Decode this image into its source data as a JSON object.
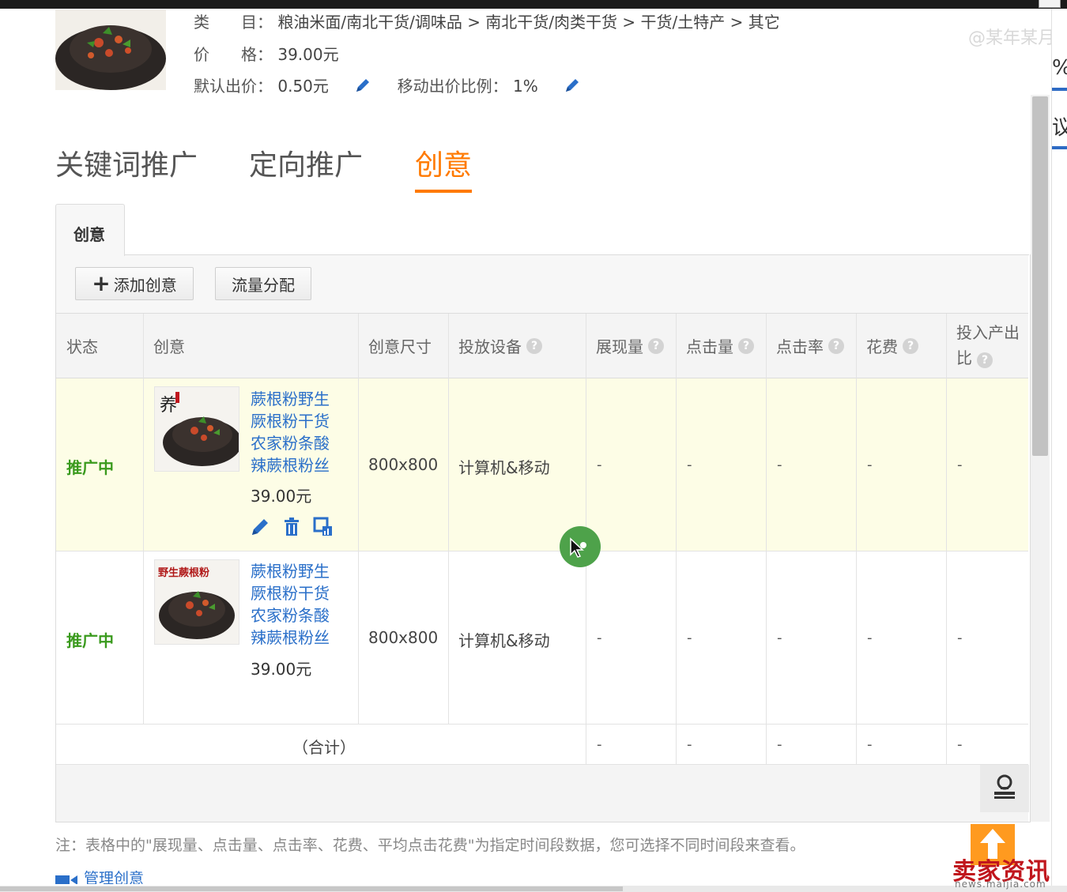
{
  "product": {
    "category_label": "类　　目：",
    "category_value": "粮油米面/南北干货/调味品 > 南北干货/肉类干货 > 干货/土特产 > 其它",
    "price_label": "价　　格：",
    "price_value": "39.00元",
    "default_bid_label": "默认出价：",
    "default_bid_value": "0.50元",
    "mobile_ratio_label": "移动出价比例：",
    "mobile_ratio_value": "1%"
  },
  "watermark": "@某年某月",
  "right_panel": {
    "text1": "%",
    "text2": "议"
  },
  "main_tabs": [
    {
      "label": "关键词推广",
      "active": false
    },
    {
      "label": "定向推广",
      "active": false
    },
    {
      "label": "创意",
      "active": true
    }
  ],
  "sub_tab": {
    "label": "创意"
  },
  "toolbar": {
    "add_label": "添加创意",
    "traffic_label": "流量分配"
  },
  "table": {
    "headers": {
      "status": "状态",
      "creative": "创意",
      "size": "创意尺寸",
      "device": "投放设备",
      "impressions": "展现量",
      "clicks": "点击量",
      "ctr": "点击率",
      "cost": "花费",
      "roi_line1": "投入产出",
      "roi_line2": "比"
    },
    "rows": [
      {
        "status": "推广中",
        "title_lines": [
          "蕨根粉野生",
          "厥根粉干货",
          "农家粉条酸",
          "辣蕨根粉丝"
        ],
        "price": "39.00元",
        "size": "800x800",
        "device": "计算机&移动",
        "impressions": "-",
        "clicks": "-",
        "ctr": "-",
        "cost": "-",
        "roi": "-",
        "image_overlay": "养"
      },
      {
        "status": "推广中",
        "title_lines": [
          "蕨根粉野生",
          "厥根粉干货",
          "农家粉条酸",
          "辣蕨根粉丝"
        ],
        "price": "39.00元",
        "size": "800x800",
        "device": "计算机&移动",
        "impressions": "-",
        "clicks": "-",
        "ctr": "-",
        "cost": "-",
        "roi": "-",
        "image_overlay": "野生蕨根粉"
      }
    ],
    "total": {
      "label": "（合计）",
      "impressions": "-",
      "clicks": "-",
      "ctr": "-",
      "cost": "-",
      "roi": "-"
    }
  },
  "note": "注：表格中的\"展现量、点击量、点击率、花费、平均点击花费\"为指定时间段数据，您可选择不同时间段来查看。",
  "manage_link": "管理创意",
  "brand": {
    "name": "卖家资讯",
    "url": "news.maijia.com"
  },
  "colors": {
    "accent": "#ff7a00",
    "link": "#2a6fc9",
    "status_green": "#3a9a1d",
    "row_highlight": "#fdfde6"
  }
}
